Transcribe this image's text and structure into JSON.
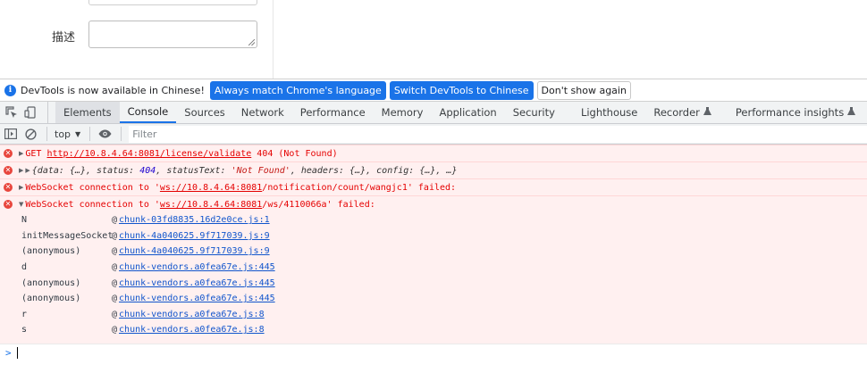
{
  "page": {
    "description_label": "描述"
  },
  "infobar": {
    "message": "DevTools is now available in Chinese!",
    "btn_match": "Always match Chrome's language",
    "btn_switch": "Switch DevTools to Chinese",
    "btn_dismiss": "Don't show again"
  },
  "tabs": [
    {
      "label": "Elements"
    },
    {
      "label": "Console"
    },
    {
      "label": "Sources"
    },
    {
      "label": "Network"
    },
    {
      "label": "Performance"
    },
    {
      "label": "Memory"
    },
    {
      "label": "Application"
    },
    {
      "label": "Security"
    },
    {
      "label": "Lighthouse"
    },
    {
      "label": "Recorder"
    },
    {
      "label": "Performance insights"
    }
  ],
  "console_toolbar": {
    "context": "top",
    "filter_placeholder": "Filter"
  },
  "messages": {
    "m1": {
      "method": "GET",
      "url": "http://10.8.4.64:8081/license/validate",
      "status": "404 (Not Found)"
    },
    "m2": {
      "open": "{data: ",
      "data_val": "{…}",
      "status_key": ", status: ",
      "status_val": "404",
      "statusText_key": ", statusText: ",
      "statusText_val": "'Not Found'",
      "headers_key": ", headers: ",
      "headers_val": "{…}",
      "config_key": ", config: ",
      "config_val": "{…}",
      "close": ", …}"
    },
    "m3": {
      "prefix": "WebSocket connection to '",
      "url": "ws://10.8.4.64:8081",
      "path": "/notification/count/wangjc1",
      "suffix": "' failed:"
    },
    "m4": {
      "prefix": "WebSocket connection to '",
      "url": "ws://10.8.4.64:8081",
      "path": "/ws/4110066a",
      "suffix": "' failed:"
    }
  },
  "stack": [
    {
      "fn": "N",
      "src": "chunk-03fd8835.16d2e0ce.js:1"
    },
    {
      "fn": "initMessageSocket",
      "src": "chunk-4a040625.9f717039.js:9"
    },
    {
      "fn": "(anonymous)",
      "src": "chunk-4a040625.9f717039.js:9"
    },
    {
      "fn": "d",
      "src": "chunk-vendors.a0fea67e.js:445"
    },
    {
      "fn": "(anonymous)",
      "src": "chunk-vendors.a0fea67e.js:445"
    },
    {
      "fn": "(anonymous)",
      "src": "chunk-vendors.a0fea67e.js:445"
    },
    {
      "fn": "r",
      "src": "chunk-vendors.a0fea67e.js:8"
    },
    {
      "fn": "s",
      "src": "chunk-vendors.a0fea67e.js:8"
    }
  ],
  "stack_at": "@",
  "colors": {
    "accent": "#1a73e8",
    "error_bg": "#fff0f0",
    "error_text": "#e50000"
  }
}
